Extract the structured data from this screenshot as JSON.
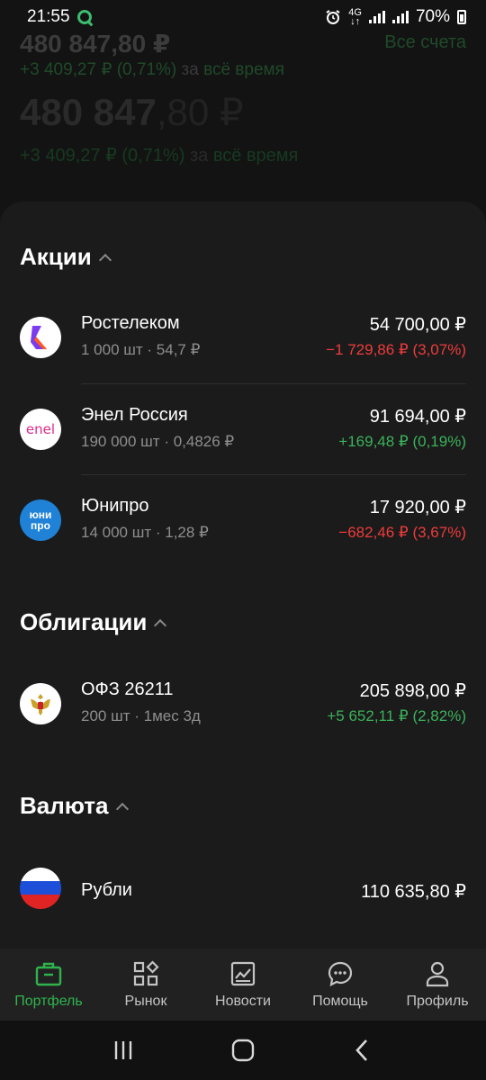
{
  "status_bar": {
    "time": "21:55",
    "network_top": "4G",
    "network_bottom": "↓↑",
    "battery": "70%"
  },
  "header": {
    "total_small": "480 847,80 ₽",
    "change_small": "+3 409,27 ₽ (0,71%)",
    "change_period_prefix": "за",
    "change_period": "всё время",
    "accounts_link": "Все счета",
    "total_big_whole": "480 847",
    "total_big_frac": ",80 ₽",
    "change_big": "+3 409,27 ₽ (0,71%)",
    "change_big_prefix": "за",
    "change_big_period": "всё время"
  },
  "sections": {
    "stocks": {
      "title": "Акции",
      "items": [
        {
          "name": "Ростелеком",
          "sub": "1 000 шт · 54,7 ₽",
          "value": "54 700,00 ₽",
          "change": "−1 729,86 ₽ (3,07%)",
          "logo": "rostelecom-logo"
        },
        {
          "name": "Энел Россия",
          "sub": "190 000 шт · 0,4826 ₽",
          "value": "91 694,00 ₽",
          "change": "+169,48 ₽ (0,19%)",
          "logo": "enel-logo",
          "logo_text": "enel"
        },
        {
          "name": "Юнипро",
          "sub": "14 000 шт · 1,28 ₽",
          "value": "17 920,00 ₽",
          "change": "−682,46 ₽ (3,67%)",
          "logo": "unipro-logo",
          "logo_text_top": "юни",
          "logo_text_bottom": "про"
        }
      ]
    },
    "bonds": {
      "title": "Облигации",
      "items": [
        {
          "name": "ОФЗ 26211",
          "sub": "200 шт · 1мес 3д",
          "value": "205 898,00 ₽",
          "change": "+5 652,11 ₽ (2,82%)",
          "logo": "coat-of-arms-logo"
        }
      ]
    },
    "currency": {
      "title": "Валюта",
      "items": [
        {
          "name": "Рубли",
          "value": "110 635,80 ₽",
          "logo": "russia-flag-logo"
        }
      ]
    }
  },
  "bottom_nav": [
    {
      "label": "Портфель",
      "icon": "briefcase-icon",
      "active": true
    },
    {
      "label": "Рынок",
      "icon": "market-grid-icon"
    },
    {
      "label": "Новости",
      "icon": "news-chart-icon"
    },
    {
      "label": "Помощь",
      "icon": "chat-help-icon"
    },
    {
      "label": "Профиль",
      "icon": "profile-icon"
    }
  ],
  "colors": {
    "accent_green": "#2fb44d",
    "negative_red": "#ee3b3b",
    "positive_green": "#3bb25a",
    "sheet_bg": "#1b1b1b"
  }
}
